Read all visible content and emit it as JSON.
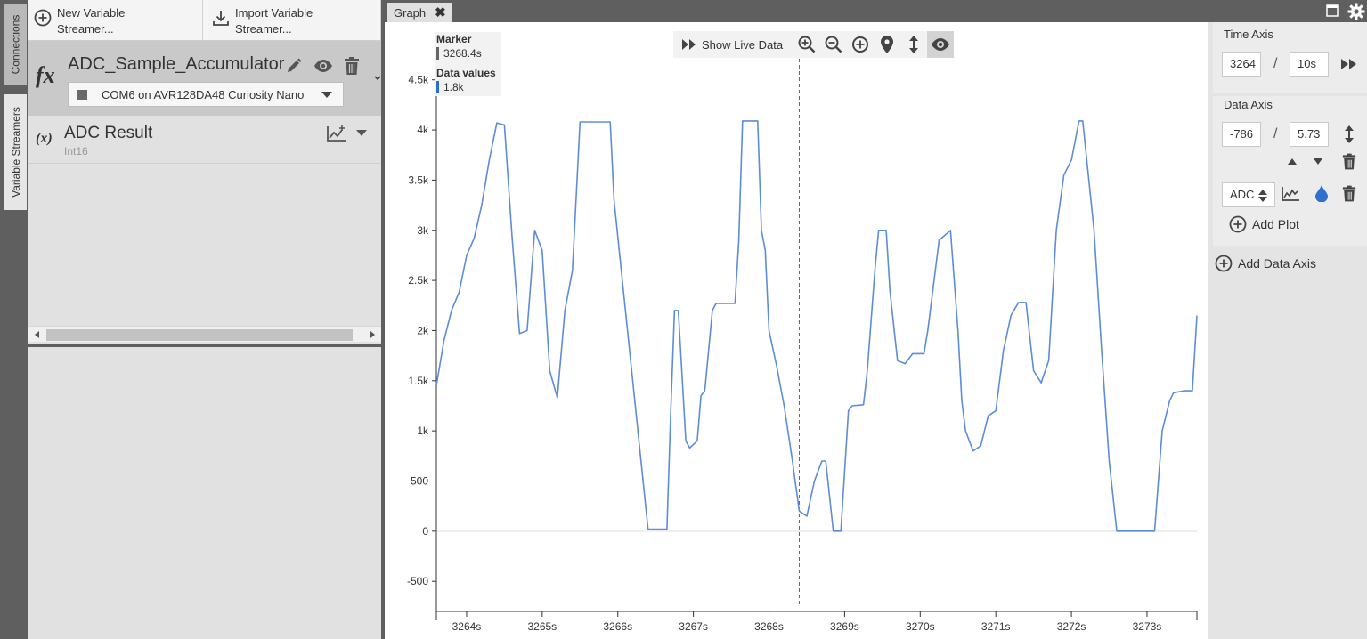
{
  "sidebar_tabs": {
    "connections": "Connections",
    "variable_streamers": "Variable Streamers"
  },
  "toolbar": {
    "new_streamer": "New Variable Streamer...",
    "import_streamer": "Import Variable Streamer..."
  },
  "streamer": {
    "name": "ADC_Sample_Accumulator",
    "source": "COM6 on AVR128DA48 Curiosity Nano",
    "variable": {
      "name": "ADC Result",
      "type": "Int16"
    }
  },
  "tab": {
    "label": "Graph",
    "close": "✖"
  },
  "graph_toolbar": {
    "live_label": "Show Live Data"
  },
  "legend": {
    "marker_title": "Marker",
    "marker_value": "3268.4s",
    "data_title": "Data values",
    "data_value": "1.8k"
  },
  "right_panel": {
    "time_axis": {
      "title": "Time Axis",
      "start": "3264",
      "span": "10s",
      "separator": "/"
    },
    "data_axis": {
      "title": "Data Axis",
      "min": "-786",
      "max": "5.73",
      "separator": "/",
      "plot_select": "ADC"
    },
    "add_plot": "Add Plot",
    "add_data_axis": "Add Data Axis"
  },
  "colors": {
    "series": "#5b8dd9",
    "marker_line": "#666666",
    "accent_blue": "#2f6fd0"
  },
  "chart_data": {
    "type": "line",
    "xlabel": "",
    "ylabel": "",
    "xlim": [
      3263.6,
      3273.66
    ],
    "ylim": [
      -800,
      4950
    ],
    "x_ticks": [
      "3264s",
      "3265s",
      "3266s",
      "3267s",
      "3268s",
      "3269s",
      "3270s",
      "3271s",
      "3272s",
      "3273s"
    ],
    "x_tick_values": [
      3264,
      3265,
      3266,
      3267,
      3268,
      3269,
      3270,
      3271,
      3272,
      3273
    ],
    "y_ticks": [
      "-500",
      "0",
      "500",
      "1k",
      "1.5k",
      "2k",
      "2.5k",
      "3k",
      "3.5k",
      "4k",
      "4.5k"
    ],
    "y_tick_values": [
      -500,
      0,
      500,
      1000,
      1500,
      2000,
      2500,
      3000,
      3500,
      4000,
      4500
    ],
    "marker_x": 3268.4,
    "series": [
      {
        "name": "ADC",
        "x": [
          3263.6,
          3263.7,
          3263.8,
          3263.9,
          3264.0,
          3264.1,
          3264.2,
          3264.3,
          3264.4,
          3264.5,
          3264.6,
          3264.7,
          3264.8,
          3264.9,
          3265.0,
          3265.1,
          3265.2,
          3265.3,
          3265.4,
          3265.5,
          3265.6,
          3265.7,
          3265.8,
          3265.9,
          3265.95,
          3266.4,
          3266.55,
          3266.65,
          3266.7,
          3266.75,
          3266.8,
          3266.9,
          3266.95,
          3267.05,
          3267.1,
          3267.15,
          3267.25,
          3267.3,
          3267.4,
          3267.5,
          3267.55,
          3267.6,
          3267.65,
          3267.85,
          3267.9,
          3267.95,
          3268.0,
          3268.1,
          3268.2,
          3268.3,
          3268.4,
          3268.5,
          3268.6,
          3268.7,
          3268.75,
          3268.85,
          3268.9,
          3268.95,
          3269.05,
          3269.1,
          3269.25,
          3269.3,
          3269.4,
          3269.45,
          3269.55,
          3269.6,
          3269.7,
          3269.8,
          3269.9,
          3269.95,
          3270.05,
          3270.1,
          3270.25,
          3270.4,
          3270.5,
          3270.55,
          3270.6,
          3270.7,
          3270.8,
          3270.9,
          3271.0,
          3271.1,
          3271.2,
          3271.3,
          3271.4,
          3271.5,
          3271.6,
          3271.7,
          3271.8,
          3271.9,
          3272.0,
          3272.1,
          3272.15,
          3272.3,
          3272.4,
          3272.5,
          3272.6,
          3272.7,
          3272.75,
          3272.9,
          3273.0,
          3273.1,
          3273.2,
          3273.3,
          3273.35,
          3273.5,
          3273.6,
          3273.66
        ],
        "y": [
          1450,
          1900,
          2200,
          2380,
          2750,
          2920,
          3250,
          3700,
          4070,
          4050,
          2950,
          1970,
          2000,
          3000,
          2800,
          1600,
          1330,
          2200,
          2600,
          4080,
          4080,
          4080,
          4080,
          4080,
          3300,
          20,
          20,
          20,
          1200,
          2200,
          2200,
          900,
          830,
          900,
          1350,
          1400,
          2200,
          2270,
          2270,
          2270,
          2270,
          2900,
          4090,
          4090,
          3000,
          2800,
          2000,
          1650,
          1250,
          750,
          200,
          150,
          500,
          700,
          700,
          0,
          0,
          0,
          1200,
          1250,
          1260,
          1600,
          2600,
          3000,
          3000,
          2400,
          1700,
          1670,
          1770,
          1770,
          1770,
          2000,
          2900,
          3000,
          2000,
          1300,
          1000,
          800,
          850,
          1150,
          1200,
          1800,
          2150,
          2280,
          2280,
          1600,
          1480,
          1700,
          3000,
          3550,
          3700,
          4090,
          4090,
          3000,
          1800,
          700,
          0,
          0,
          0,
          0,
          0,
          0,
          1000,
          1300,
          1380,
          1400,
          1400,
          2150
        ]
      }
    ]
  }
}
